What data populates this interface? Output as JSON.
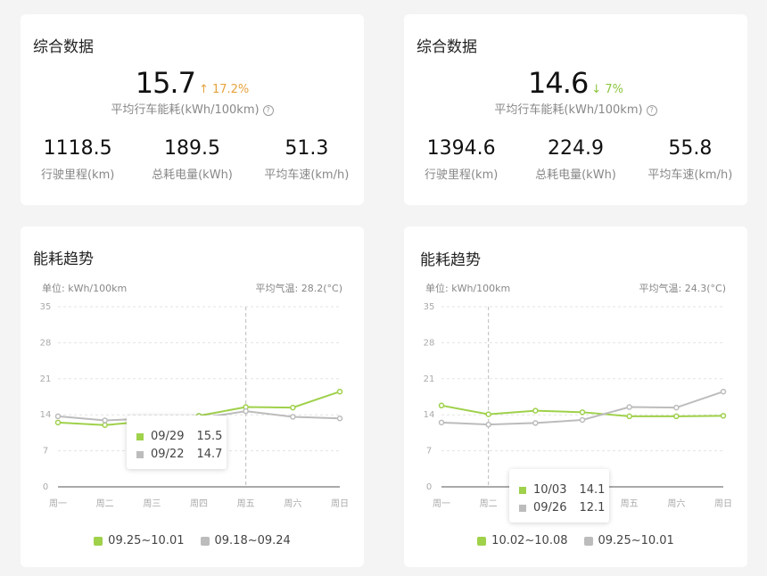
{
  "colors": {
    "current": "#9fd14b",
    "previous": "#bcbcbc",
    "up": "#e6a23c",
    "down": "#8cc63f"
  },
  "panels": [
    {
      "summary": {
        "title": "综合数据",
        "main_value": "15.7",
        "delta": "↑ 17.2%",
        "delta_dir": "up",
        "main_label": "平均行车能耗(kWh/100km)",
        "stats": [
          {
            "value": "1118.5",
            "label": "行驶里程(km)"
          },
          {
            "value": "189.5",
            "label": "总耗电量(kWh)"
          },
          {
            "value": "51.3",
            "label": "平均车速(km/h)"
          }
        ]
      },
      "trend": {
        "title": "能耗趋势",
        "unit": "单位:  kWh/100km",
        "temp": "平均气温:  28.2(°C)",
        "tooltip": {
          "rows": [
            {
              "date": "09/29",
              "value": "15.5"
            },
            {
              "date": "09/22",
              "value": "14.7"
            }
          ]
        },
        "legend": [
          "09.25~10.01",
          "09.18~09.24"
        ]
      },
      "chart_data": {
        "type": "line",
        "categories": [
          "周一",
          "周二",
          "周三",
          "周四",
          "周五",
          "周六",
          "周日"
        ],
        "ylim": [
          0,
          35
        ],
        "yticks": [
          0,
          7,
          14,
          21,
          28,
          35
        ],
        "series": [
          {
            "name": "09.25~10.01",
            "values": [
              12.5,
              12.0,
              12.8,
              13.8,
              15.5,
              15.4,
              18.5
            ]
          },
          {
            "name": "09.18~09.24",
            "values": [
              13.7,
              12.9,
              13.3,
              13.3,
              14.7,
              13.6,
              13.3
            ]
          }
        ],
        "highlight_index": 4
      }
    },
    {
      "summary": {
        "title": "综合数据",
        "main_value": "14.6",
        "delta": "↓ 7%",
        "delta_dir": "down",
        "main_label": "平均行车能耗(kWh/100km)",
        "stats": [
          {
            "value": "1394.6",
            "label": "行驶里程(km)"
          },
          {
            "value": "224.9",
            "label": "总耗电量(kWh)"
          },
          {
            "value": "55.8",
            "label": "平均车速(km/h)"
          }
        ]
      },
      "trend": {
        "title": "能耗趋势",
        "unit": "单位:  kWh/100km",
        "temp": "平均气温:  24.3(°C)",
        "tooltip": {
          "rows": [
            {
              "date": "10/03",
              "value": "14.1"
            },
            {
              "date": "09/26",
              "value": "12.1"
            }
          ]
        },
        "legend": [
          "10.02~10.08",
          "09.25~10.01"
        ]
      },
      "chart_data": {
        "type": "line",
        "categories": [
          "周一",
          "周二",
          "周三",
          "周四",
          "周五",
          "周六",
          "周日"
        ],
        "ylim": [
          0,
          35
        ],
        "yticks": [
          0,
          7,
          14,
          21,
          28,
          35
        ],
        "series": [
          {
            "name": "10.02~10.08",
            "values": [
              15.8,
              14.1,
              14.8,
              14.5,
              13.7,
              13.7,
              13.8
            ]
          },
          {
            "name": "09.25~10.01",
            "values": [
              12.5,
              12.1,
              12.4,
              13.0,
              15.5,
              15.4,
              18.5
            ]
          }
        ],
        "highlight_index": 1
      }
    }
  ]
}
